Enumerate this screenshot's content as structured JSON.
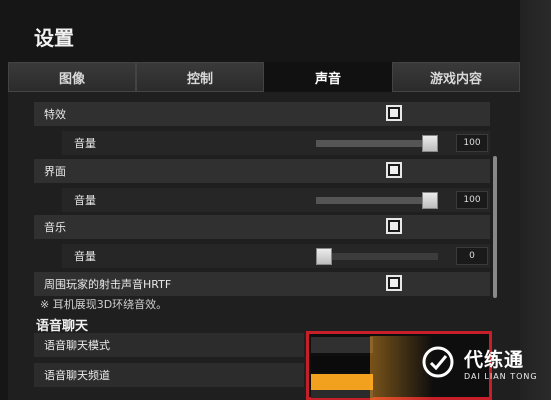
{
  "title": "设置",
  "tabs": [
    {
      "label": "图像",
      "active": false
    },
    {
      "label": "控制",
      "active": false
    },
    {
      "label": "声音",
      "active": true
    },
    {
      "label": "游戏内容",
      "active": false
    }
  ],
  "settings": {
    "effects": {
      "label": "特效",
      "checked": true,
      "volume_label": "音量",
      "volume_value": "100",
      "volume_fraction": 1.0
    },
    "ui": {
      "label": "界面",
      "checked": true,
      "volume_label": "音量",
      "volume_value": "100",
      "volume_fraction": 1.0
    },
    "music": {
      "label": "音乐",
      "checked": true,
      "volume_label": "音量",
      "volume_value": "0",
      "volume_fraction": 0.0
    },
    "hrtf": {
      "label": "周围玩家的射击声音HRTF",
      "checked": true,
      "note": "※ 耳机展现3D环绕音效。"
    }
  },
  "voice_chat": {
    "section_title": "语音聊天",
    "mode_label": "语音聊天模式",
    "channel_label": "语音聊天频道",
    "highlight_color": "#c71f2a",
    "selected_option_color": "#f2a11e"
  },
  "watermark": {
    "brand": "代练通",
    "brand_en": "DAI LIAN TONG"
  },
  "colors": {
    "background": "#161616",
    "active_tab": "#111111",
    "accent_orange": "#f2a11e",
    "border_red": "#c71f2a"
  }
}
